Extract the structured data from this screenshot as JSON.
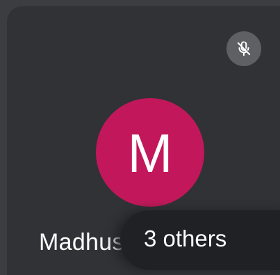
{
  "tile": {
    "participant_name": "Madhusmita",
    "avatar_initial": "M",
    "avatar_color": "#c2185b",
    "mic_status_icon": "mic-off-icon"
  },
  "overflow": {
    "others_label": "3 others"
  }
}
